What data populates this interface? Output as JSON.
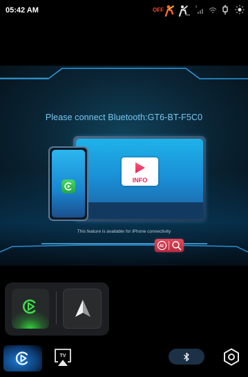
{
  "status": {
    "time": "05:42 AM",
    "seatbelt_status": "OFF",
    "icons": [
      "airbag-off-icon",
      "passenger-airbag-on-icon",
      "signal-icon",
      "wifi-icon",
      "usb-icon",
      "brightness-icon"
    ]
  },
  "main": {
    "connect_text": "Please connect Bluetooth:GT6-BT-F5C0",
    "feature_text": "This feature is available for iPhone connectivity",
    "info_label": "INFO"
  },
  "dock": {
    "apps": [
      {
        "name": "carplay",
        "icon": "carplay-icon"
      },
      {
        "name": "navigation",
        "icon": "navigation-arrow-icon"
      }
    ]
  },
  "bottom_bar": {
    "items": [
      "carplay-icon",
      "airplay-tv-icon",
      "bluetooth-icon",
      "settings-icon"
    ],
    "tv_label": "TV"
  },
  "colors": {
    "accent_blue": "#79c6ee",
    "carplay_green": "#34d13c",
    "seatbelt_red": "#ff4a2a"
  }
}
